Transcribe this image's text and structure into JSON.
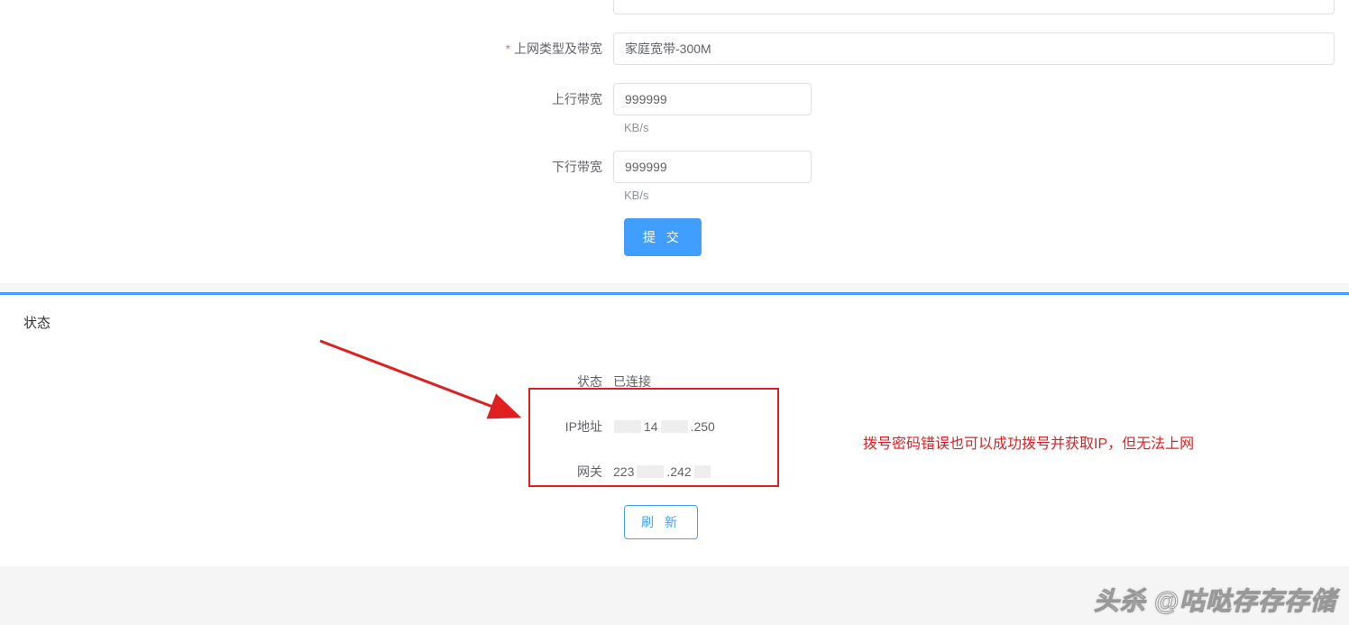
{
  "form": {
    "field0_value": "",
    "conn_type_label": "上网类型及带宽",
    "conn_type_value": "家庭宽带-300M",
    "upload_label": "上行带宽",
    "upload_value": "999999",
    "upload_unit": "KB/s",
    "download_label": "下行带宽",
    "download_value": "999999",
    "download_unit": "KB/s",
    "submit_label": "提 交"
  },
  "status": {
    "panel_title": "状态",
    "state_label": "状态",
    "state_value": "已连接",
    "ip_label": "IP地址",
    "ip_p1": "14",
    "ip_p2": ".250",
    "gw_label": "网关",
    "gw_p1": "223",
    "gw_p2": ".242",
    "refresh_label": "刷 新"
  },
  "annotation": "拨号密码错误也可以成功拨号并获取IP，但无法上网",
  "watermark": "头杀 @咕哒存存存储"
}
